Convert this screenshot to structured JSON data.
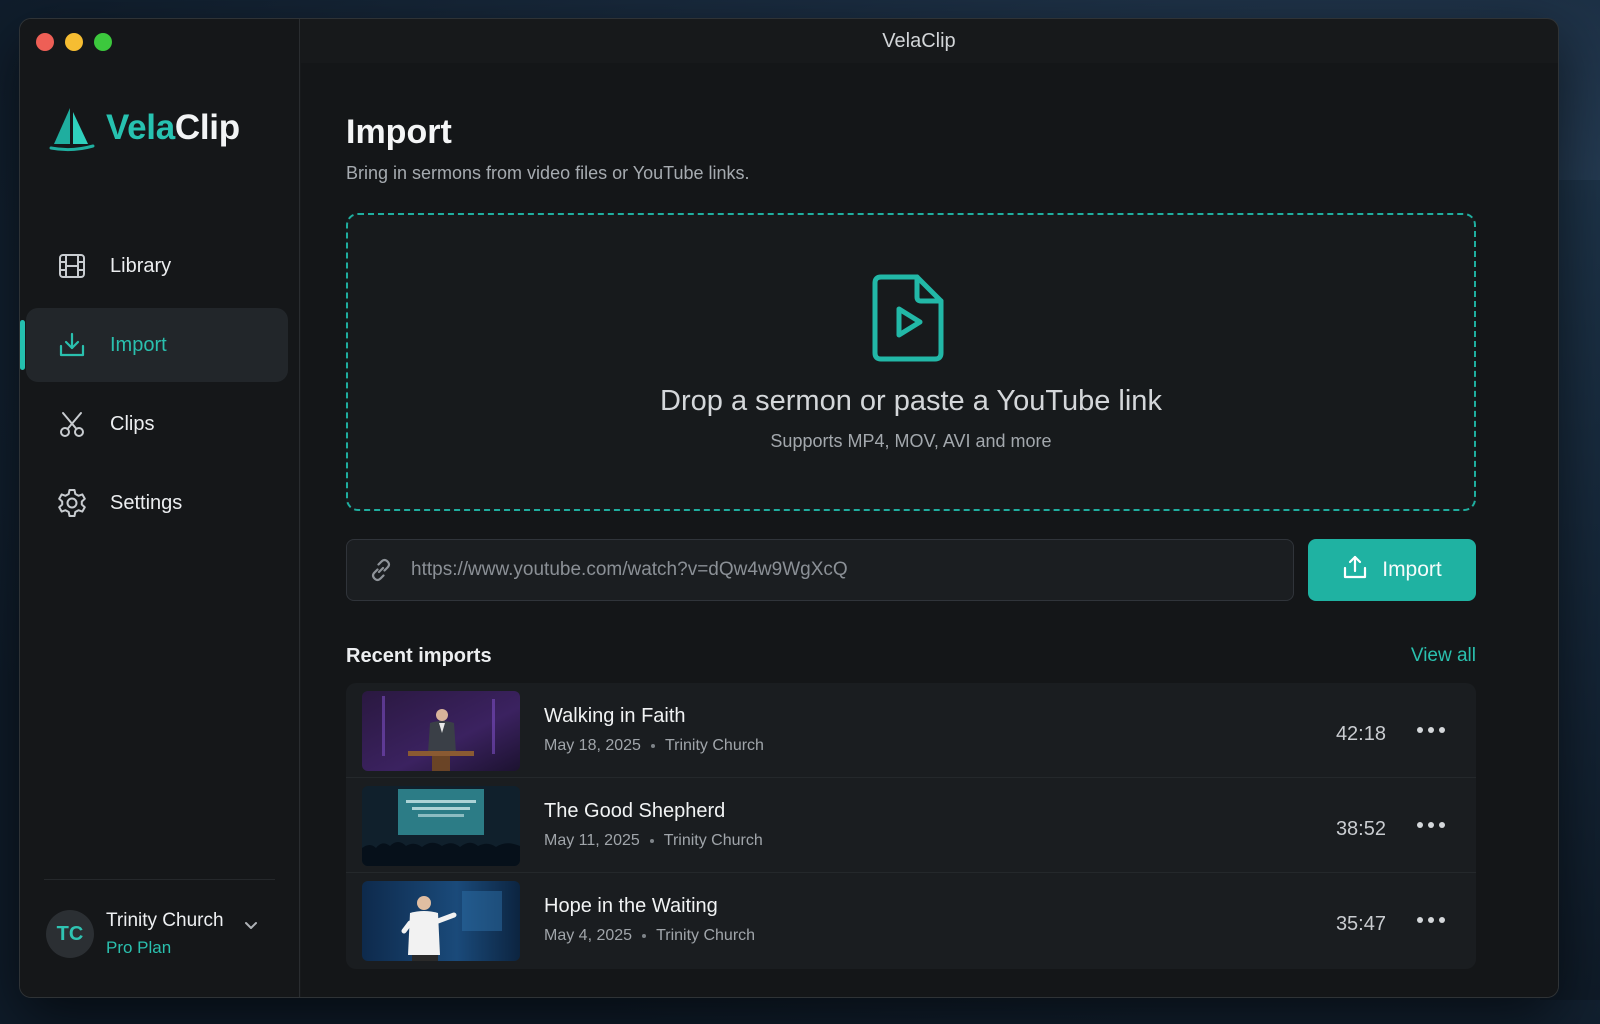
{
  "window": {
    "title": "VelaClip"
  },
  "brand": {
    "name_part1": "Vela",
    "name_part2": "Clip",
    "accent": "#24bfae"
  },
  "sidebar": {
    "items": [
      {
        "label": "Library",
        "icon": "film-icon",
        "active": false
      },
      {
        "label": "Import",
        "icon": "download-tray-icon",
        "active": true
      },
      {
        "label": "Clips",
        "icon": "scissors-icon",
        "active": false
      },
      {
        "label": "Settings",
        "icon": "gear-icon",
        "active": false
      }
    ]
  },
  "account": {
    "initials": "TC",
    "name": "Trinity Church",
    "plan": "Pro Plan"
  },
  "main": {
    "title": "Import",
    "subtitle": "Bring in sermons from video files or YouTube links.",
    "dropzone": {
      "title": "Drop a sermon or paste a YouTube link",
      "subtitle": "Supports MP4, MOV, AVI and more"
    },
    "url": {
      "value": "https://www.youtube.com/watch?v=dQw4w9WgXcQ"
    },
    "import_button": "Import",
    "recent": {
      "title": "Recent imports",
      "view_all": "View all",
      "items": [
        {
          "title": "Walking in Faith",
          "date": "May 18, 2025",
          "church": "Trinity Church",
          "duration": "42:18"
        },
        {
          "title": "The Good Shepherd",
          "date": "May 11, 2025",
          "church": "Trinity Church",
          "duration": "38:52"
        },
        {
          "title": "Hope in the Waiting",
          "date": "May 4, 2025",
          "church": "Trinity Church",
          "duration": "35:47"
        }
      ]
    }
  }
}
